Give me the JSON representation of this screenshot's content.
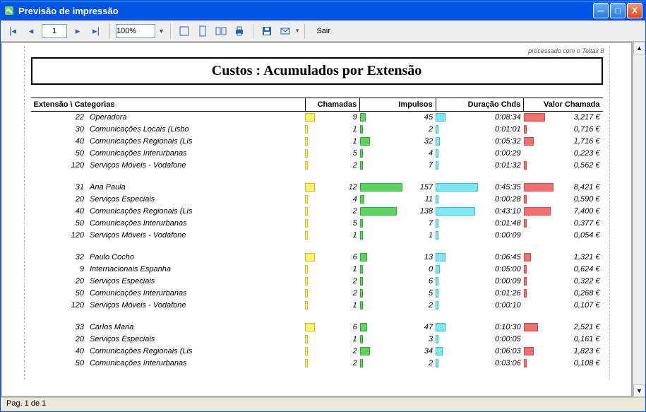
{
  "window": {
    "title": "Previsão de impressão"
  },
  "toolbar": {
    "page_value": "1",
    "zoom_value": "100%",
    "exit_label": "Sair"
  },
  "report": {
    "processed_text": "processado com o Teltax 8",
    "title": "Custos :  Acumulados por Extensão",
    "headers": {
      "ext_cat": "Extensão  \\ Categorias",
      "chamadas": "Chamadas",
      "impulsos": "Impulsos",
      "duracao": "Duração Chds",
      "valor": "Valor Chamada"
    },
    "groups": [
      {
        "id": "22",
        "name": "Operadora",
        "chamadas": "9",
        "ch_bar": 14,
        "impulsos": "45",
        "imp_bar": 8,
        "duracao": "0:08:34",
        "dur_bar": 14,
        "valor": "3,217 €",
        "val_bar": 30,
        "rows": [
          {
            "id": "30",
            "name": "Comunicações Locais  (Lisbo",
            "chamadas": "1",
            "ch_bar": 4,
            "impulsos": "2",
            "imp_bar": 4,
            "duracao": "0:01:01",
            "dur_bar": 4,
            "valor": "0,716 €"
          },
          {
            "id": "40",
            "name": "Comunicações Regionais (Lis",
            "chamadas": "1",
            "ch_bar": 14,
            "impulsos": "32",
            "imp_bar": 6,
            "duracao": "0:05:32",
            "dur_bar": 14,
            "valor": "1,716 €"
          },
          {
            "id": "50",
            "name": "Comunicações Interurbanas",
            "chamadas": "5",
            "ch_bar": 4,
            "impulsos": "4",
            "imp_bar": 4,
            "duracao": "0:00:29",
            "dur_bar": 0,
            "valor": "0,223 €"
          },
          {
            "id": "120",
            "name": "Serviços Móveis - Vodafone",
            "chamadas": "2",
            "ch_bar": 4,
            "impulsos": "7",
            "imp_bar": 4,
            "duracao": "0:01:32",
            "dur_bar": 4,
            "valor": "0,562 €"
          }
        ]
      },
      {
        "id": "31",
        "name": "Ana Paula",
        "chamadas": "12",
        "ch_bar": 14,
        "impulsos": "157",
        "imp_bar": 60,
        "duracao": "0:45:35",
        "dur_bar": 60,
        "valor": "8,421 €",
        "val_bar": 42,
        "rows": [
          {
            "id": "20",
            "name": "Serviços Especiais",
            "chamadas": "4",
            "ch_bar": 6,
            "impulsos": "11",
            "imp_bar": 4,
            "duracao": "0:00:28",
            "dur_bar": 4,
            "valor": "0,590 €"
          },
          {
            "id": "40",
            "name": "Comunicações Regionais (Lis",
            "chamadas": "2",
            "ch_bar": 52,
            "impulsos": "138",
            "imp_bar": 56,
            "duracao": "0:43:10",
            "dur_bar": 38,
            "valor": "7,400 €"
          },
          {
            "id": "50",
            "name": "Comunicações Interurbanas",
            "chamadas": "5",
            "ch_bar": 4,
            "impulsos": "7",
            "imp_bar": 4,
            "duracao": "0:01:48",
            "dur_bar": 4,
            "valor": "0,377 €"
          },
          {
            "id": "120",
            "name": "Serviços Móveis - Vodafone",
            "chamadas": "1",
            "ch_bar": 4,
            "impulsos": "1",
            "imp_bar": 4,
            "duracao": "0:00:09",
            "dur_bar": 0,
            "valor": "0,054 €"
          }
        ]
      },
      {
        "id": "32",
        "name": "Paulo Cocho",
        "chamadas": "6",
        "ch_bar": 14,
        "impulsos": "13",
        "imp_bar": 10,
        "duracao": "0:06:45",
        "dur_bar": 14,
        "valor": "1,321 €",
        "val_bar": 10,
        "rows": [
          {
            "id": "9",
            "name": "Internacionais Espanha",
            "chamadas": "1",
            "ch_bar": 4,
            "impulsos": "0",
            "imp_bar": 6,
            "duracao": "0:05:00",
            "dur_bar": 4,
            "valor": "0,624 €"
          },
          {
            "id": "20",
            "name": "Serviços Especiais",
            "chamadas": "2",
            "ch_bar": 4,
            "impulsos": "6",
            "imp_bar": 4,
            "duracao": "0:00:09",
            "dur_bar": 4,
            "valor": "0,322 €"
          },
          {
            "id": "50",
            "name": "Comunicações Interurbanas",
            "chamadas": "2",
            "ch_bar": 4,
            "impulsos": "5",
            "imp_bar": 4,
            "duracao": "0:01:26",
            "dur_bar": 4,
            "valor": "0,268 €"
          },
          {
            "id": "120",
            "name": "Serviços Móveis - Vodafone",
            "chamadas": "1",
            "ch_bar": 4,
            "impulsos": "2",
            "imp_bar": 4,
            "duracao": "0:00:10",
            "dur_bar": 0,
            "valor": "0,107 €"
          }
        ]
      },
      {
        "id": "33",
        "name": "Carlos Maria",
        "chamadas": "6",
        "ch_bar": 14,
        "impulsos": "47",
        "imp_bar": 10,
        "duracao": "0:10:30",
        "dur_bar": 14,
        "valor": "2,521 €",
        "val_bar": 20,
        "rows": [
          {
            "id": "20",
            "name": "Serviços Especiais",
            "chamadas": "1",
            "ch_bar": 4,
            "impulsos": "3",
            "imp_bar": 4,
            "duracao": "0:00:05",
            "dur_bar": 0,
            "valor": "0,161 €"
          },
          {
            "id": "40",
            "name": "Comunicações Regionais (Lis",
            "chamadas": "2",
            "ch_bar": 14,
            "impulsos": "34",
            "imp_bar": 10,
            "duracao": "0:06:03",
            "dur_bar": 14,
            "valor": "1,823 €"
          },
          {
            "id": "50",
            "name": "Comunicações Interurbanas",
            "chamadas": "2",
            "ch_bar": 4,
            "impulsos": "2",
            "imp_bar": 4,
            "duracao": "0:03:06",
            "dur_bar": 4,
            "valor": "0,108 €"
          }
        ]
      }
    ]
  },
  "status": {
    "page_text": "Pag. 1  de  1"
  },
  "chart_data": {
    "type": "table",
    "title": "Custos : Acumulados por Extensão",
    "columns": [
      "Extensão",
      "Categoria",
      "Chamadas",
      "Impulsos",
      "Duração Chds",
      "Valor Chamada (€)"
    ],
    "rows": [
      [
        "22",
        "Operadora (total)",
        9,
        45,
        "0:08:34",
        3.217
      ],
      [
        "22",
        "30 Comunicações Locais (Lisbo",
        1,
        2,
        "0:01:01",
        0.716
      ],
      [
        "22",
        "40 Comunicações Regionais (Lis",
        1,
        32,
        "0:05:32",
        1.716
      ],
      [
        "22",
        "50 Comunicações Interurbanas",
        5,
        4,
        "0:00:29",
        0.223
      ],
      [
        "22",
        "120 Serviços Móveis - Vodafone",
        2,
        7,
        "0:01:32",
        0.562
      ],
      [
        "31",
        "Ana Paula (total)",
        12,
        157,
        "0:45:35",
        8.421
      ],
      [
        "31",
        "20 Serviços Especiais",
        4,
        11,
        "0:00:28",
        0.59
      ],
      [
        "31",
        "40 Comunicações Regionais (Lis",
        2,
        138,
        "0:43:10",
        7.4
      ],
      [
        "31",
        "50 Comunicações Interurbanas",
        5,
        7,
        "0:01:48",
        0.377
      ],
      [
        "31",
        "120 Serviços Móveis - Vodafone",
        1,
        1,
        "0:00:09",
        0.054
      ],
      [
        "32",
        "Paulo Cocho (total)",
        6,
        13,
        "0:06:45",
        1.321
      ],
      [
        "32",
        "9 Internacionais Espanha",
        1,
        0,
        "0:05:00",
        0.624
      ],
      [
        "32",
        "20 Serviços Especiais",
        2,
        6,
        "0:00:09",
        0.322
      ],
      [
        "32",
        "50 Comunicações Interurbanas",
        2,
        5,
        "0:01:26",
        0.268
      ],
      [
        "32",
        "120 Serviços Móveis - Vodafone",
        1,
        2,
        "0:00:10",
        0.107
      ],
      [
        "33",
        "Carlos Maria (total)",
        6,
        47,
        "0:10:30",
        2.521
      ],
      [
        "33",
        "20 Serviços Especiais",
        1,
        3,
        "0:00:05",
        0.161
      ],
      [
        "33",
        "40 Comunicações Regionais (Lis",
        2,
        34,
        "0:06:03",
        1.823
      ],
      [
        "33",
        "50 Comunicações Interurbanas",
        2,
        2,
        "0:03:06",
        0.108
      ]
    ]
  }
}
